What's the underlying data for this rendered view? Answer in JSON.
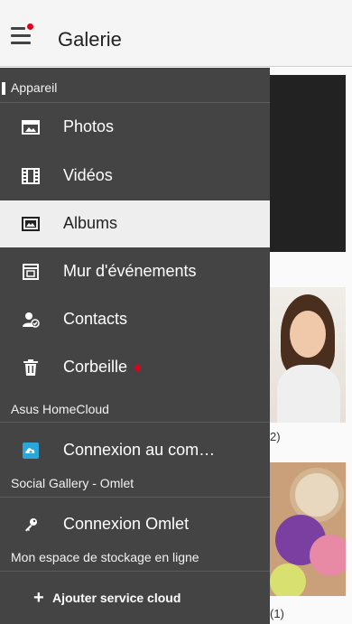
{
  "app": {
    "title": "Galerie",
    "menu_has_notification": true
  },
  "drawer": {
    "device_section": {
      "title": "Appareil",
      "items": [
        {
          "label": "Photos",
          "icon": "photos-icon",
          "selected": false
        },
        {
          "label": "Vidéos",
          "icon": "film-icon",
          "selected": false
        },
        {
          "label": "Albums",
          "icon": "albums-icon",
          "selected": true
        },
        {
          "label": "Mur d'événements",
          "icon": "event-wall-icon",
          "selected": false
        },
        {
          "label": "Contacts",
          "icon": "contacts-icon",
          "selected": false
        },
        {
          "label": "Corbeille",
          "icon": "trash-icon",
          "selected": false,
          "has_badge": true
        }
      ]
    },
    "homecloud_section": {
      "title": "Asus HomeCloud",
      "item": {
        "label": "Connexion au com…",
        "icon": "cloud-icon"
      }
    },
    "social_section": {
      "title": "Social Gallery - Omlet",
      "item": {
        "label": "Connexion Omlet",
        "icon": "key-icon"
      }
    },
    "storage_section": {
      "title": "Mon espace de stockage en ligne",
      "add_label": "Ajouter service cloud",
      "add_icon": "plus-icon"
    }
  },
  "gallery": {
    "album_count_1": "2)",
    "album_count_2": "(1)"
  },
  "colors": {
    "drawer_bg": "#444444",
    "selected_bg": "#eeeeee",
    "notification": "#e0001b",
    "cloud_icon": "#2aa6d9"
  }
}
